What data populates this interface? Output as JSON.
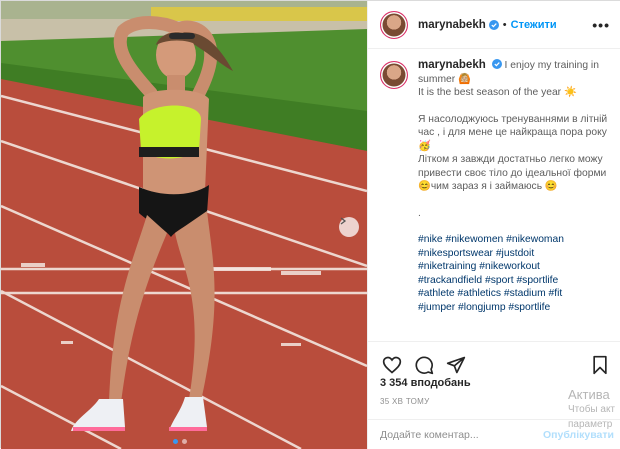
{
  "colors": {
    "link": "#0095f6",
    "hashtag": "#00376b",
    "verified": "#3897f0",
    "track": "#b24a3a"
  },
  "header": {
    "username": "marynabekh",
    "separator": "•",
    "follow_label": "Стежити",
    "more_icon": "more-horizontal-icon",
    "more_label": "•••"
  },
  "caption": {
    "username": "marynabekh",
    "line1": "I enjoy my training in summer 🙆🏼",
    "line2": "It is the best season of the year ☀️",
    "ua1": "Я насолоджуюсь тренуваннями в літній час , і для мене це найкраща пора року 🥳",
    "ua2": "Літком я завжди достатньо легко можу привести своє тіло до ідеальної форми 😊чим зараз я і займаюсь 😊",
    "dot": ".",
    "tags": [
      "#nike #nikewomen #nikewoman",
      "#nikesportswear #justdoit",
      "#niketraining #nikeworkout",
      "#trackandfield #sport #sportlife",
      "#athlete #athletics #stadium #fit",
      "#jumper #longjump #sportlife"
    ]
  },
  "actions": {
    "like_icon": "heart-icon",
    "comment_icon": "comment-icon",
    "share_icon": "share-icon",
    "save_icon": "bookmark-icon"
  },
  "likes": "3 354 вподобань",
  "time": "35 ХВ ТОМУ",
  "comment": {
    "placeholder": "Додайте коментар...",
    "publish_label": "Опублікувати"
  },
  "carousel": {
    "total": 2,
    "active": 1
  },
  "watermark": {
    "title": "Актива",
    "line1": "Чтобы акт",
    "line2": "параметр"
  }
}
